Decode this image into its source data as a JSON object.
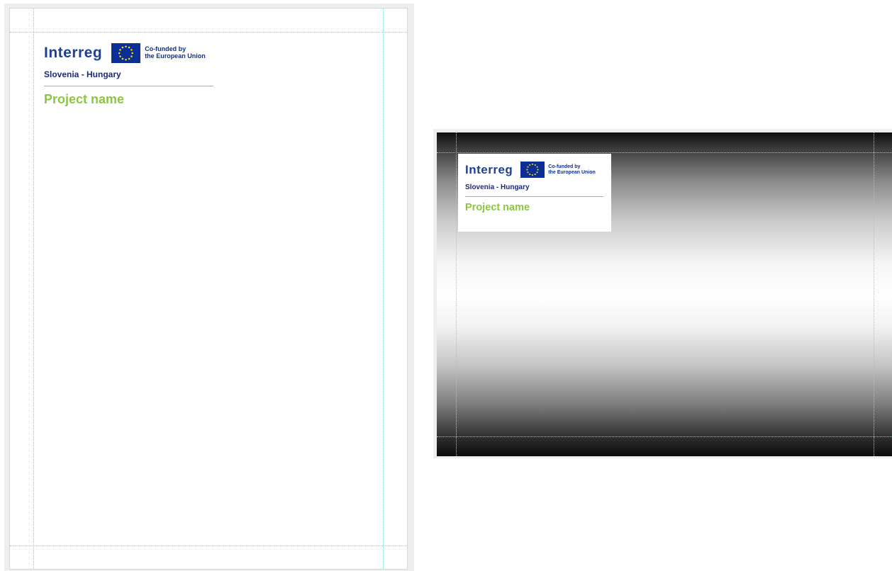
{
  "header": {
    "logo_word": "Interreg",
    "cofund_line1": "Co-funded by",
    "cofund_line2": "the European Union",
    "region": "Slovenia - Hungary",
    "project_name": "Project name"
  },
  "colors": {
    "interreg_blue": "#1f3f97",
    "eu_flag_blue": "#0c2f95",
    "eu_star_yellow": "#ffdd00",
    "region_navy": "#1c2a78",
    "project_green": "#8cc63f",
    "guide_cyan": "#7fd4d8"
  },
  "icons": {
    "flag": "eu-flag-icon"
  }
}
